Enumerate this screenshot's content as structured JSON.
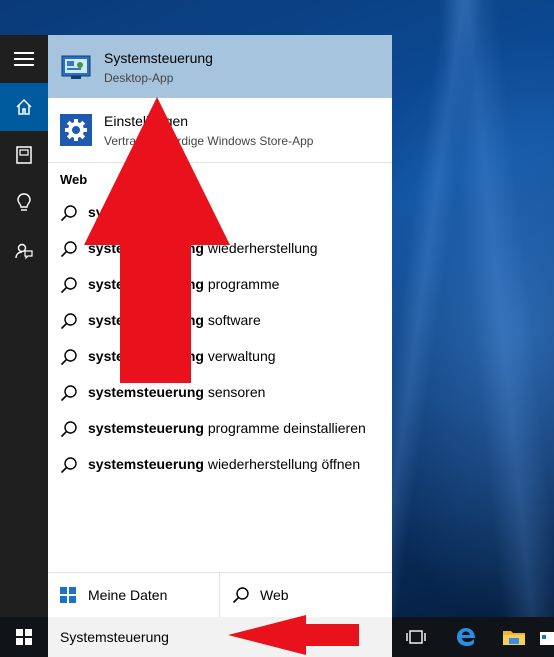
{
  "best_match": {
    "title": "Systemsteuerung",
    "subtitle": "Desktop-App",
    "icon": "control-panel-icon"
  },
  "second_match": {
    "title": "Einstellungen",
    "subtitle": "Vertrauenswürdige Windows Store-App",
    "icon": "gear-icon"
  },
  "web_section_label": "Web",
  "suggestions": [
    {
      "bold": "systemsteuerung",
      "rest": ""
    },
    {
      "bold": "systemsteuerung",
      "rest": " wiederherstellung"
    },
    {
      "bold": "systemsteuerung",
      "rest": " programme"
    },
    {
      "bold": "systemsteuerung",
      "rest": " software"
    },
    {
      "bold": "systemsteuerung",
      "rest": " verwaltung"
    },
    {
      "bold": "systemsteuerung",
      "rest": " sensoren"
    },
    {
      "bold": "systemsteuerung",
      "rest": " programme deinstallieren"
    },
    {
      "bold": "systemsteuerung",
      "rest": " wiederherstellung öffnen"
    }
  ],
  "bottom": {
    "my_data_label": "Meine Daten",
    "web_label": "Web"
  },
  "search": {
    "value": "Systemsteuerung"
  },
  "colors": {
    "accent": "#005a9e",
    "highlight": "#a7c4df",
    "arrow": "#e8111c"
  }
}
